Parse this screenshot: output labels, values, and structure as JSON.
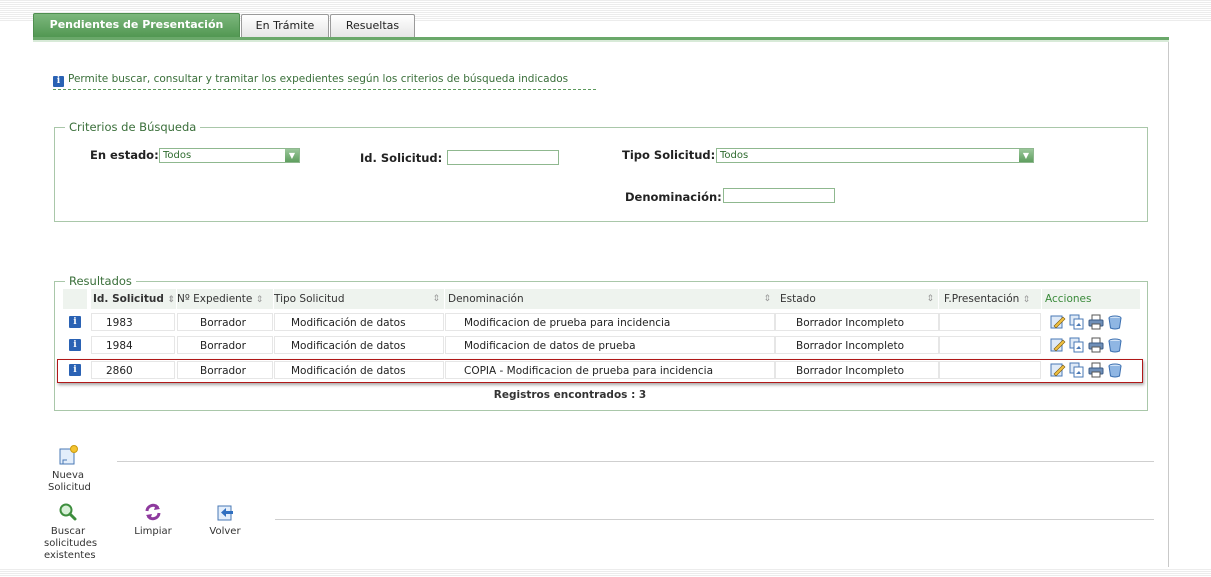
{
  "tabs": [
    {
      "label": "Pendientes de Presentación",
      "active": true
    },
    {
      "label": "En Trámite",
      "active": false
    },
    {
      "label": "Resueltas",
      "active": false
    }
  ],
  "info_text": "Permite buscar, consultar y tramitar los expedientes según los criterios de búsqueda indicados",
  "search": {
    "legend": "Criterios de Búsqueda",
    "estado_label": "En estado:",
    "estado_value": "Todos",
    "id_label": "Id. Solicitud:",
    "id_value": "",
    "tipo_label": "Tipo Solicitud:",
    "tipo_value": "Todos",
    "denominacion_label": "Denominación:",
    "denominacion_value": ""
  },
  "results": {
    "legend": "Resultados",
    "columns": [
      "Id. Solicitud",
      "Nº Expediente",
      "Tipo Solicitud",
      "Denominación",
      "Estado",
      "F.Presentación",
      "Acciones"
    ],
    "rows": [
      {
        "id": "1983",
        "expediente": "Borrador",
        "tipo": "Modificación de datos",
        "denominacion": "Modificacion de prueba para incidencia",
        "estado": "Borrador Incompleto",
        "fecha": ""
      },
      {
        "id": "1984",
        "expediente": "Borrador",
        "tipo": "Modificación de datos",
        "denominacion": "Modificacion de datos de prueba",
        "estado": "Borrador Incompleto",
        "fecha": ""
      },
      {
        "id": "2860",
        "expediente": "Borrador",
        "tipo": "Modificación de datos",
        "denominacion": "COPIA - Modificacion de prueba para incidencia",
        "estado": "Borrador Incompleto",
        "fecha": ""
      }
    ],
    "selected_row": 2,
    "count_text": "Registros encontrados : 3",
    "row_actions": [
      "edit-icon",
      "copy-icon",
      "print-icon",
      "delete-icon"
    ]
  },
  "toolbar": {
    "new_label_1": "Nueva",
    "new_label_2": "Solicitud",
    "search_label_1": "Buscar",
    "search_label_2": "solicitudes",
    "search_label_3": "existentes",
    "clear_label": "Limpiar",
    "back_label": "Volver"
  },
  "colors": {
    "accent": "#4f9650",
    "selection": "#b01818",
    "info_icon": "#2a62b4"
  }
}
